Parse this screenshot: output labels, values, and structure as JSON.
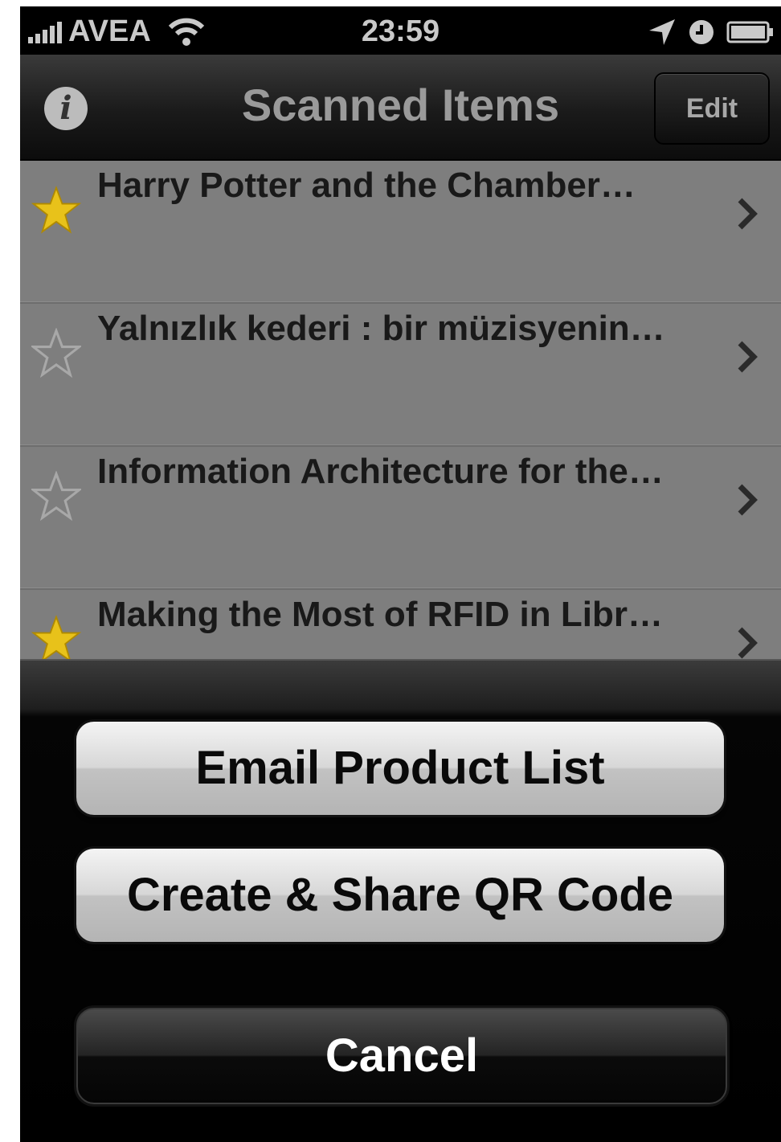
{
  "status_bar": {
    "carrier": "AVEA",
    "time": "23:59"
  },
  "nav": {
    "title": "Scanned Items",
    "info_label": "i",
    "edit_label": "Edit"
  },
  "items": [
    {
      "title": "Harry Potter and the Chamber…",
      "favorite": true
    },
    {
      "title": "Yalnızlık kederi : bir müzisyenin…",
      "favorite": false
    },
    {
      "title": "Information Architecture for the…",
      "favorite": false
    },
    {
      "title": "Making the Most of RFID in Libr…",
      "favorite": true
    }
  ],
  "action_sheet": {
    "email_label": "Email Product List",
    "qr_label": "Create & Share QR Code",
    "cancel_label": "Cancel"
  },
  "colors": {
    "star_filled": "#e8c21a",
    "star_outline": "#a8a8a8"
  }
}
